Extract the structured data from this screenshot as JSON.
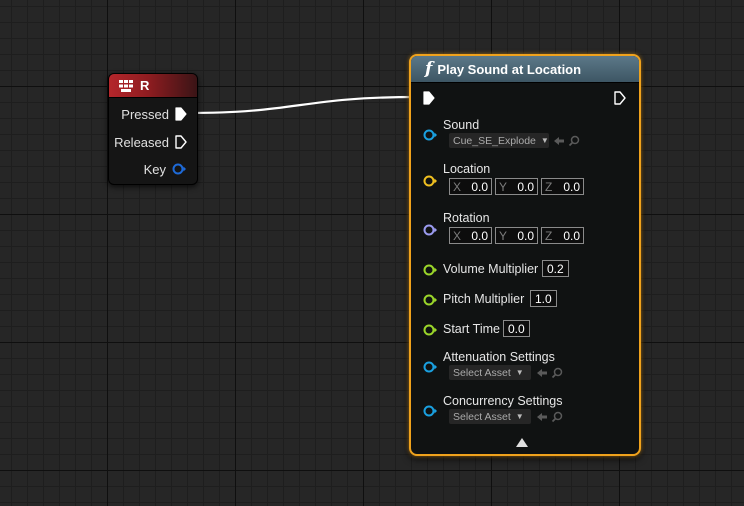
{
  "key_node": {
    "title": "R",
    "pins": [
      {
        "label": "Pressed",
        "type": "exec"
      },
      {
        "label": "Released",
        "type": "exec"
      },
      {
        "label": "Key",
        "type": "struct"
      }
    ]
  },
  "function_node": {
    "icon": "function-icon",
    "icon_glyph": "f",
    "title": "Play Sound at Location",
    "sound": {
      "label": "Sound",
      "value": "Cue_SE_Explode"
    },
    "location": {
      "label": "Location",
      "x_axis": "X",
      "x": "0.0",
      "y_axis": "Y",
      "y": "0.0",
      "z_axis": "Z",
      "z": "0.0"
    },
    "rotation": {
      "label": "Rotation",
      "x_axis": "X",
      "x": "0.0",
      "y_axis": "Y",
      "y": "0.0",
      "z_axis": "Z",
      "z": "0.0"
    },
    "volume_multiplier": {
      "label": "Volume Multiplier",
      "value": "0.2"
    },
    "pitch_multiplier": {
      "label": "Pitch Multiplier",
      "value": "1.0"
    },
    "start_time": {
      "label": "Start Time",
      "value": "0.0"
    },
    "attenuation_settings": {
      "label": "Attenuation Settings",
      "value": "Select Asset"
    },
    "concurrency_settings": {
      "label": "Concurrency Settings",
      "value": "Select Asset"
    }
  },
  "colors": {
    "exec_pin": "#ffffff",
    "object_pin": "#1aa0e0",
    "vector_pin": "#f0c020",
    "rotator_pin": "#9b9bf0",
    "float_pin": "#9bd62a",
    "struct_pin": "#1e6ad8",
    "node_selected_border": "#f0a21c",
    "key_header": "#b4262b",
    "function_header": "#4c6878"
  }
}
